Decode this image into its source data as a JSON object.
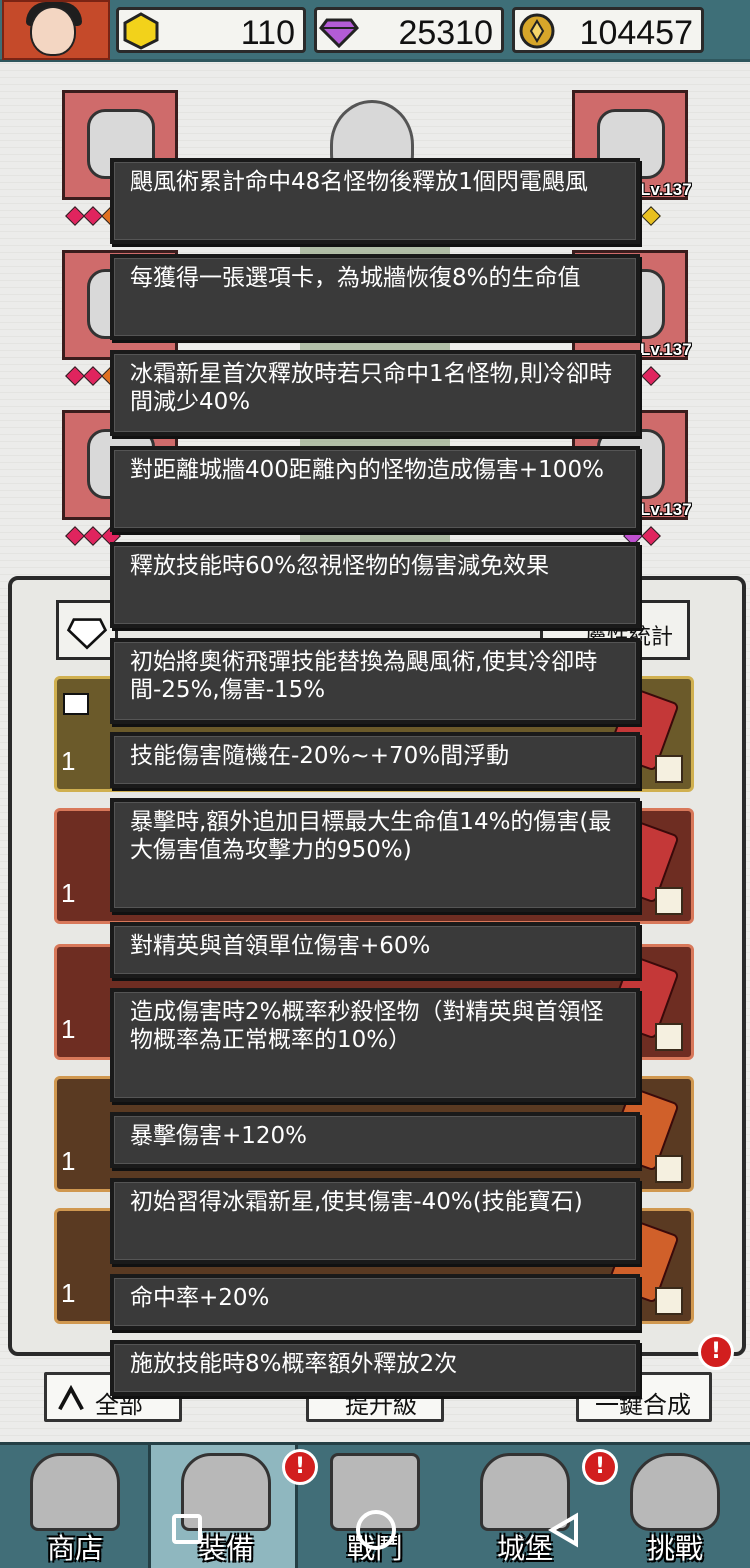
{
  "resources": {
    "energy": {
      "value": "110",
      "icon": "hexagon-energy-icon",
      "color": "#f2d21b"
    },
    "gems": {
      "value": "25310",
      "icon": "diamond-gem-icon",
      "color": "#b35cd6"
    },
    "coins": {
      "value": "104457",
      "icon": "gold-coin-icon",
      "color": "#d7a62a"
    }
  },
  "equipment": {
    "right_levels": [
      "Lv.137",
      "Lv.137",
      "Lv.137"
    ]
  },
  "panel": {
    "tabs": {
      "stats": "屬性統計"
    },
    "buttons": {
      "all": "全部",
      "upgrade": "提升級",
      "merge": "一鍵合成"
    },
    "cell_counts": [
      "1",
      "1",
      "1",
      "1",
      "1"
    ],
    "alert_mark": "!"
  },
  "tooltip": {
    "entries": [
      "颶風術累計命中48名怪物後釋放1個閃電颶風",
      "每獲得一張選項卡，為城牆恢復8%的生命值",
      "冰霜新星首次釋放時若只命中1名怪物,則冷卻時間減少40%",
      "對距離城牆400距離內的怪物造成傷害+100%",
      "釋放技能時60%忽視怪物的傷害減免效果",
      "初始將奧術飛彈技能替換為颶風術,使其冷卻時間-25%,傷害-15%",
      "技能傷害隨機在-20%~+70%間浮動",
      "暴擊時,額外追加目標最大生命值14%的傷害(最大傷害值為攻擊力的950%)",
      "對精英與首領單位傷害+60%",
      "造成傷害時2%概率秒殺怪物（對精英與首領怪物概率為正常概率的10%）",
      "暴擊傷害+120%",
      "初始習得冰霜新星,使其傷害-40%(技能寶石)",
      "命中率+20%",
      "施放技能時8%概率額外釋放2次"
    ]
  },
  "nav": {
    "items": [
      {
        "label": "商店",
        "icon": "shop-icon"
      },
      {
        "label": "裝備",
        "icon": "backpack-icon"
      },
      {
        "label": "戰鬥",
        "icon": "crossed-swords-icon"
      },
      {
        "label": "城堡",
        "icon": "castle-icon"
      },
      {
        "label": "挑戰",
        "icon": "shield-emblem-icon"
      }
    ],
    "active_index": 1
  },
  "colors": {
    "topbar": "#3e6f78",
    "tooltip_bg": "#3a3a3a",
    "alert": "#d21e1e"
  }
}
